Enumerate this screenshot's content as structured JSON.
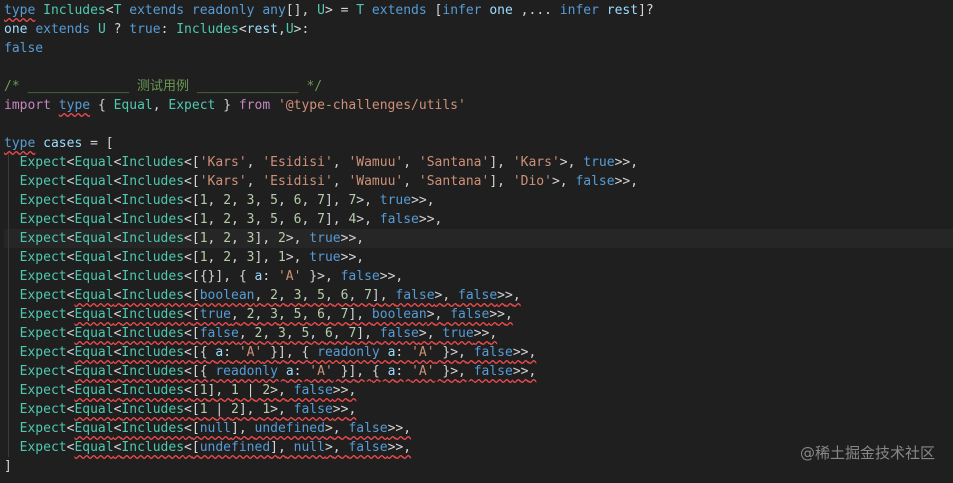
{
  "colors": {
    "background": "#1f1f1f",
    "keyword": "#569cd6",
    "type": "#4ec9b0",
    "string": "#ce9178",
    "number": "#b5cea8",
    "comment": "#6a9955",
    "error_underline": "#f14c4c"
  },
  "lines": [
    "type Includes<T extends readonly any[], U> = T extends [infer one ,... infer rest]?",
    "one extends U ? true: Includes<rest,U>:",
    "false",
    "",
    "/* _____________ 测试用例 _____________ */",
    "import type { Equal, Expect } from '@type-challenges/utils'",
    "",
    "type cases = [",
    "  Expect<Equal<Includes<['Kars', 'Esidisi', 'Wamuu', 'Santana'], 'Kars'>, true>>,",
    "  Expect<Equal<Includes<['Kars', 'Esidisi', 'Wamuu', 'Santana'], 'Dio'>, false>>,",
    "  Expect<Equal<Includes<[1, 2, 3, 5, 6, 7], 7>, true>>,",
    "  Expect<Equal<Includes<[1, 2, 3, 5, 6, 7], 4>, false>>,",
    "  Expect<Equal<Includes<[1, 2, 3], 2>, true>>,",
    "  Expect<Equal<Includes<[1, 2, 3], 1>, true>>,",
    "  Expect<Equal<Includes<[{}], { a: 'A' }>, false>>,",
    "  Expect<Equal<Includes<[boolean, 2, 3, 5, 6, 7], false>, false>>,",
    "  Expect<Equal<Includes<[true, 2, 3, 5, 6, 7], boolean>, false>>,",
    "  Expect<Equal<Includes<[false, 2, 3, 5, 6, 7], false>, true>>,",
    "  Expect<Equal<Includes<[{ a: 'A' }], { readonly a: 'A' }>, false>>,",
    "  Expect<Equal<Includes<[{ readonly a: 'A' }], { a: 'A' }>, false>>,",
    "  Expect<Equal<Includes<[1], 1 | 2>, false>>,",
    "  Expect<Equal<Includes<[1 | 2], 1>, false>>,",
    "  Expect<Equal<Includes<[null], undefined>, false>>,",
    "  Expect<Equal<Includes<[undefined], null>, false>>,",
    "]"
  ],
  "watermark": "@稀土掘金技术社区"
}
